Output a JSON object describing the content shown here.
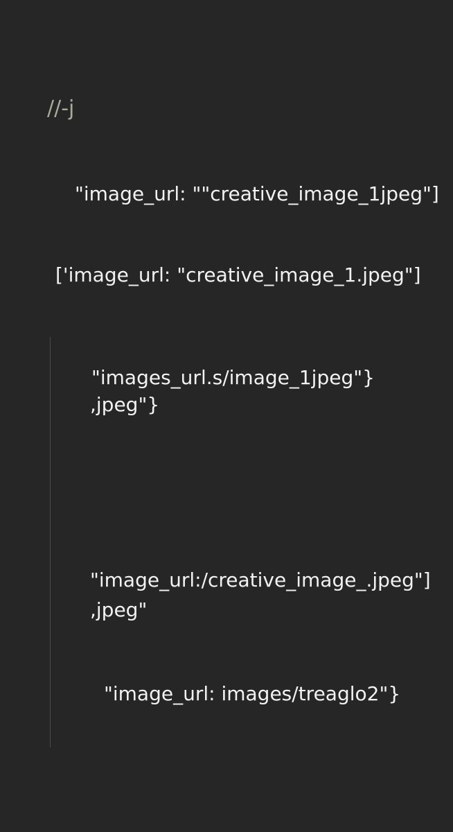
{
  "editor": {
    "lines": [
      {
        "text": "//-j"
      },
      {
        "text": "\"image_url:  \"\"creative_image_1jpeg\"]"
      },
      {
        "text": "['image_url: \"creative_image_1.jpeg\"]"
      },
      {
        "text": "\"images_url.s/image_1jpeg\"}"
      },
      {
        "text": ",jpeg\"}"
      },
      {
        "text": "\"image_url:/creative_image_.jpeg\"]"
      },
      {
        "text": ",jpeg\""
      },
      {
        "text": "\"image_url:  images/treaglo2\"}"
      }
    ]
  }
}
